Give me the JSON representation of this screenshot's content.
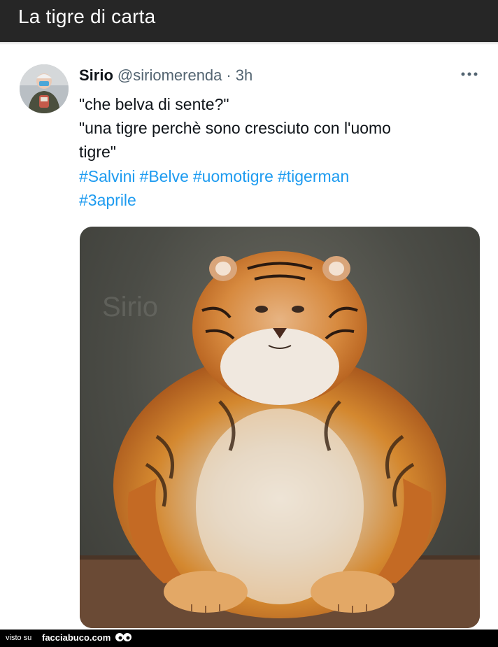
{
  "header": {
    "title": "La tigre  di carta"
  },
  "tweet": {
    "author_name": "Sirio",
    "author_handle": "@siriomerenda",
    "separator": "·",
    "time": "3h",
    "more_icon": "more-horizontal-icon",
    "lines": [
      "\"che belva di sente?\"",
      "\"una tigre perchè sono cresciuto con l'uomo",
      "tigre\""
    ],
    "hashtags": [
      "#Salvini",
      "#Belve",
      "#uomotigre",
      "#tigerman",
      "#3aprile"
    ],
    "image_watermark": "Sirio"
  },
  "footer": {
    "visto": "visto su",
    "site": "facciabuco.com"
  },
  "colors": {
    "topbar": "#262626",
    "link": "#1d9bf0",
    "text": "#0f1419",
    "muted": "#536471"
  }
}
